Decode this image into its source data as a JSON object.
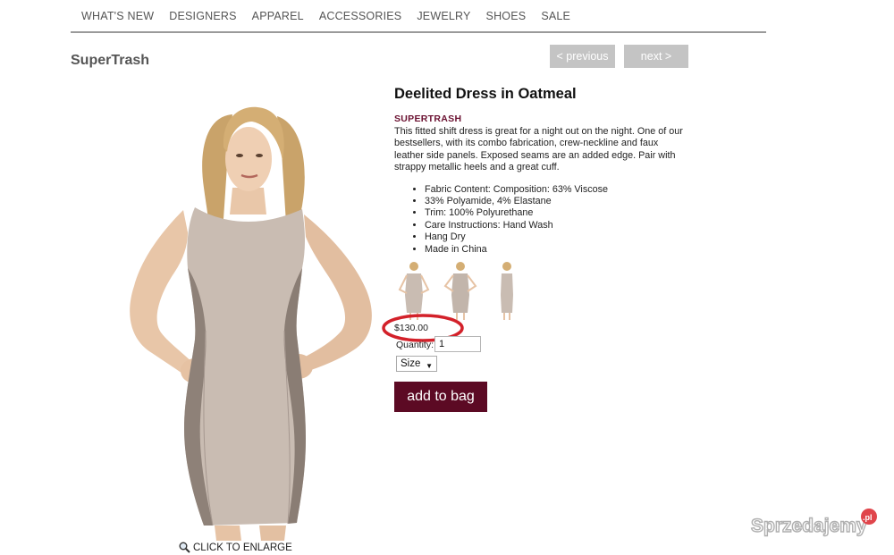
{
  "nav": {
    "items": [
      {
        "label": "WHAT'S NEW"
      },
      {
        "label": "DESIGNERS"
      },
      {
        "label": "APPAREL"
      },
      {
        "label": "ACCESSORIES"
      },
      {
        "label": "JEWELRY"
      },
      {
        "label": "SHOES"
      },
      {
        "label": "SALE"
      }
    ]
  },
  "brand_heading": "SuperTrash",
  "pager": {
    "previous_label": "< previous",
    "next_label": "next  >"
  },
  "product": {
    "title": "Deelited Dress in Oatmeal",
    "designer": "SUPERTRASH",
    "description": "This fitted shift dress is great for a night out on the night. One of our bestsellers, with its combo fabrication, crew-neckline and faux leather side panels. Exposed seams are an added edge. Pair with strappy metallic heels and a great cuff.",
    "details": [
      "Fabric Content: Composition: 63% Viscose",
      "33% Polyamide, 4% Elastane",
      "Trim: 100% Polyurethane",
      "Care Instructions: Hand Wash",
      "Hang Dry",
      "Made in China"
    ],
    "price": "$130.00",
    "quantity_label": "Quantity:",
    "quantity_value": "1",
    "size_label": "Size",
    "add_to_bag_label": "add to bag",
    "enlarge_label": "CLICK TO ENLARGE"
  },
  "watermark": {
    "text": "Sprzedajemy",
    "badge": ".pl"
  },
  "colors": {
    "accent": "#5c0a24",
    "designer": "#6a1030",
    "pager": "#c4c4c4",
    "price_ring": "#d3212a"
  },
  "icons": {
    "enlarge": "magnifier-icon",
    "size_dropdown": "caret-down-icon"
  }
}
